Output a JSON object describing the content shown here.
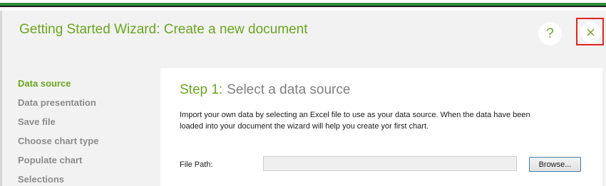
{
  "window": {
    "title": "Getting Started Wizard: Create a new document",
    "help_label": "?",
    "accent_color": "#6aa520",
    "close_highlight_color": "#e1261c"
  },
  "sidebar": {
    "items": [
      {
        "label": "Data source",
        "active": true
      },
      {
        "label": "Data presentation",
        "active": false
      },
      {
        "label": "Save file",
        "active": false
      },
      {
        "label": "Choose chart type",
        "active": false
      },
      {
        "label": "Populate chart",
        "active": false
      },
      {
        "label": "Selections",
        "active": false
      }
    ]
  },
  "step": {
    "number": "Step 1:",
    "title": "Select a data source",
    "description": "Import your own data by selecting an Excel file to use as your data source. When the data have been loaded into your document the wizard will help you create yor first chart."
  },
  "file_path": {
    "label": "File Path:",
    "value": "",
    "browse_label": "Browse..."
  },
  "icons": {
    "help": "help-icon",
    "close": "close-icon"
  }
}
